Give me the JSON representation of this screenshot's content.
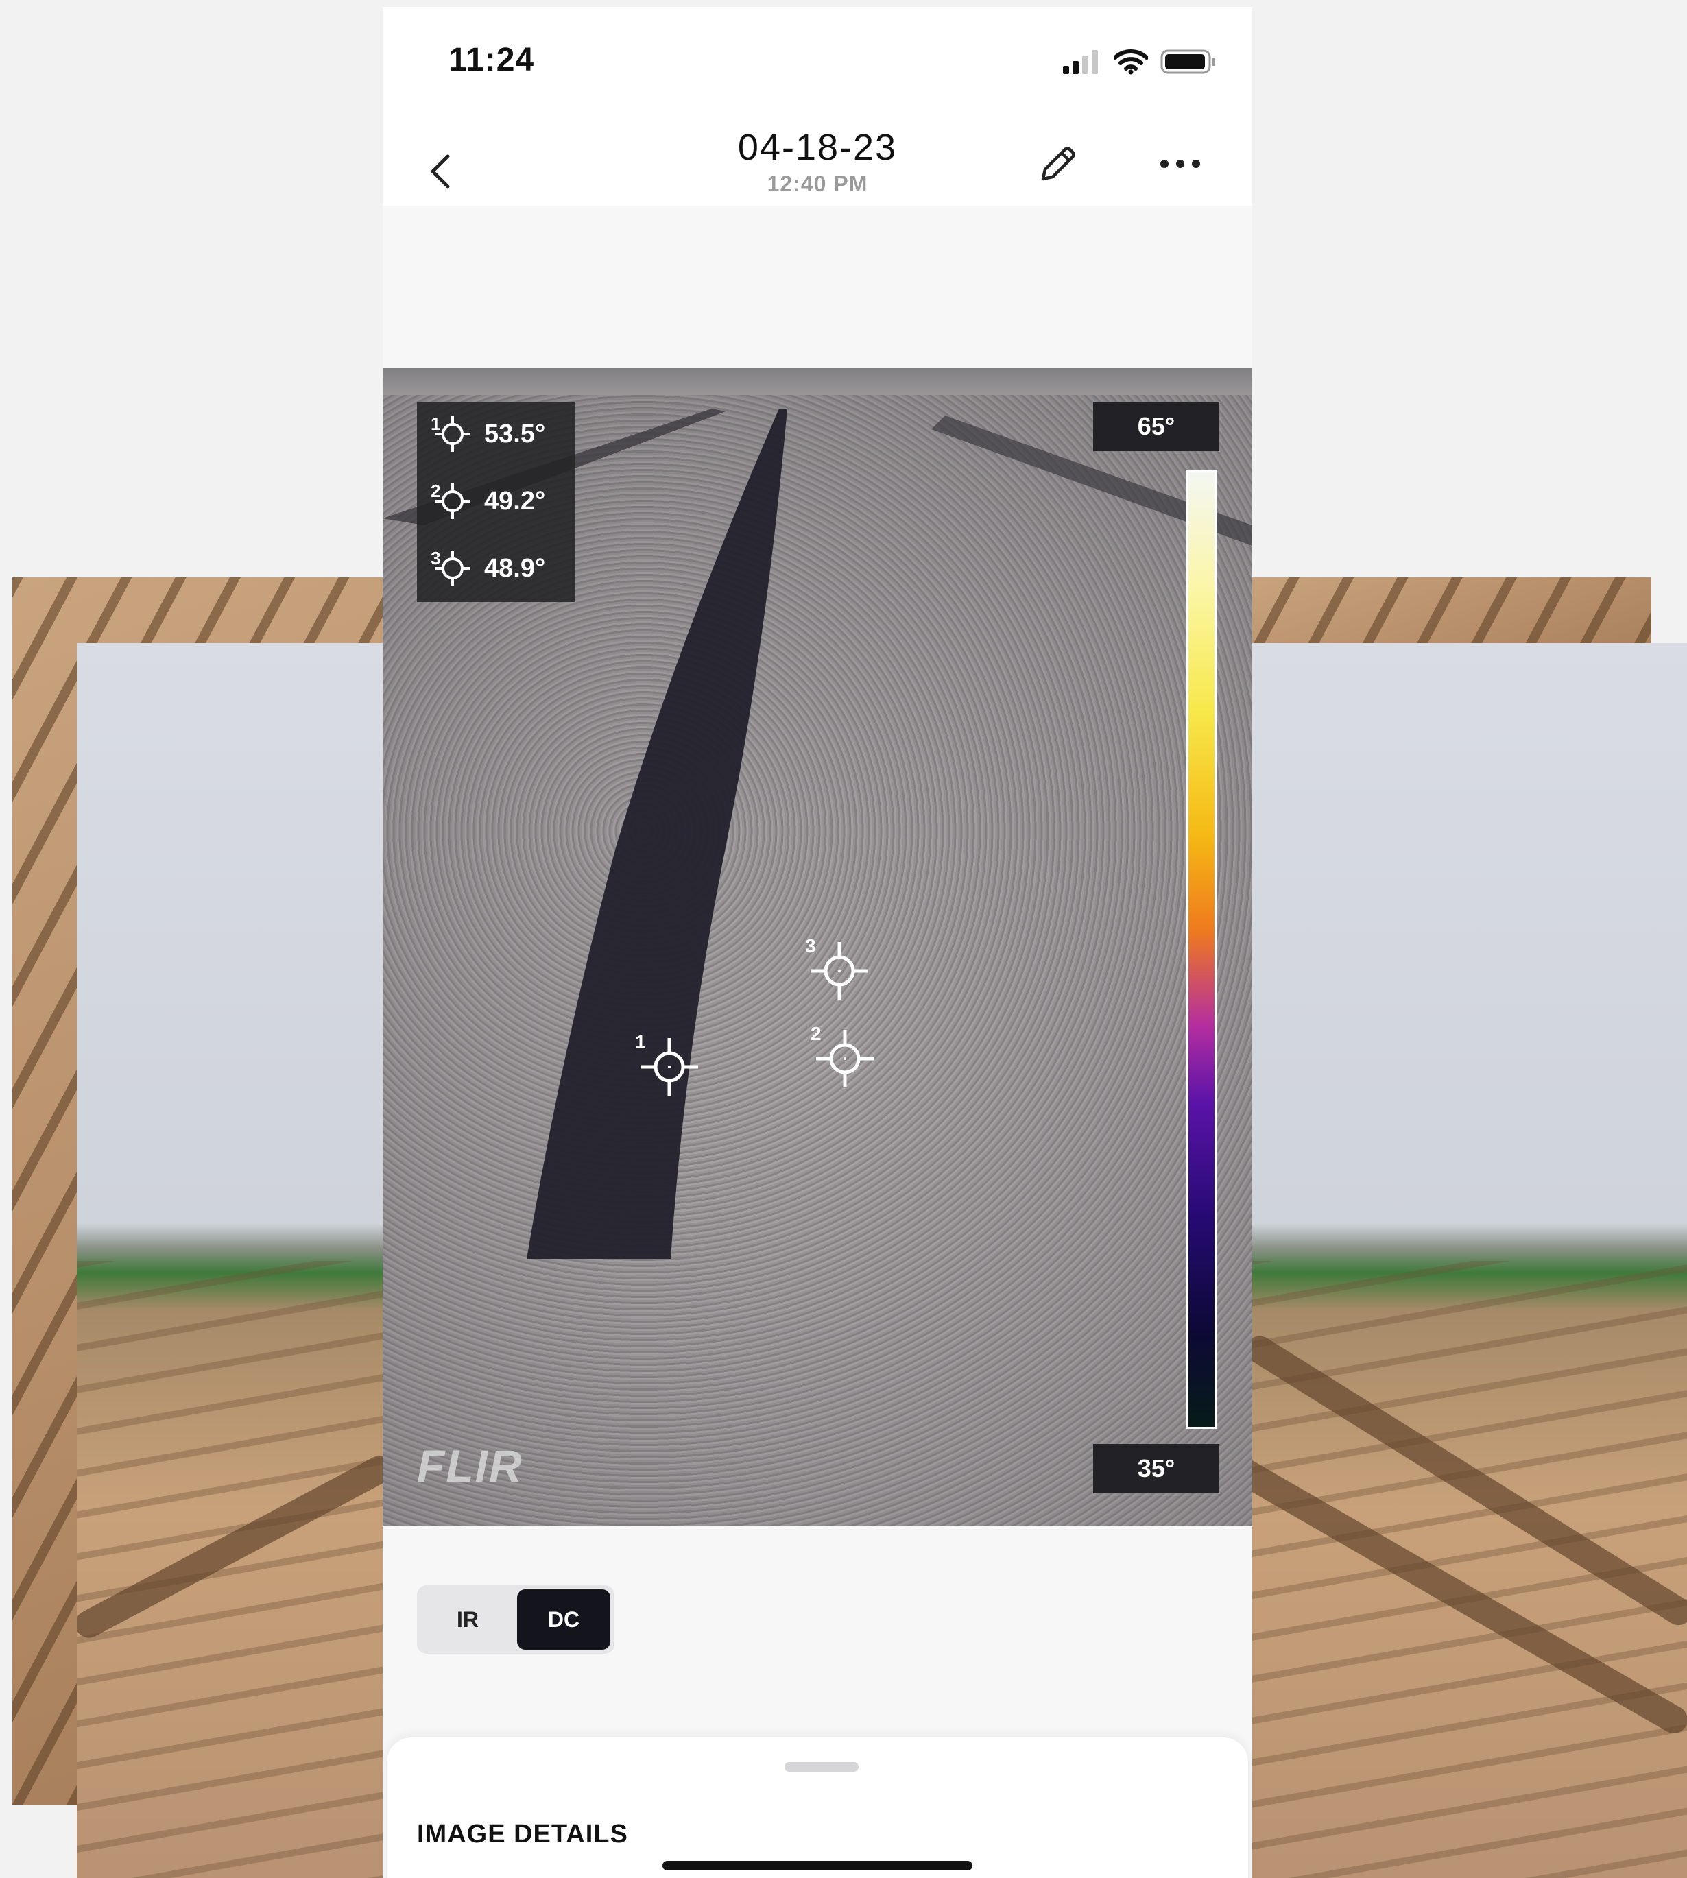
{
  "status_bar": {
    "time": "11:24"
  },
  "header": {
    "title": "04-18-23",
    "subtitle": "12:40 PM"
  },
  "measurements": [
    {
      "id": "1",
      "value": "53.5°"
    },
    {
      "id": "2",
      "value": "49.2°"
    },
    {
      "id": "3",
      "value": "48.9°"
    }
  ],
  "scale": {
    "max": "65°",
    "min": "35°"
  },
  "watermark": "FLIR",
  "mode_toggle": {
    "ir_label": "IR",
    "dc_label": "DC",
    "selected": "DC"
  },
  "details_sheet": {
    "title": "IMAGE DETAILS"
  },
  "icons": [
    "back-chevron-icon",
    "pencil-icon",
    "more-icon",
    "signal-icon",
    "wifi-icon",
    "battery-icon",
    "crosshair-icon"
  ]
}
